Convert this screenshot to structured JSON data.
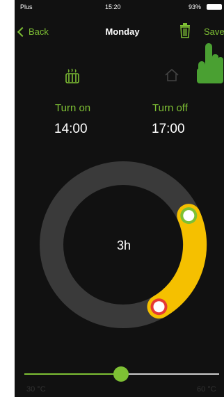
{
  "status_bar": {
    "carrier": "Plus",
    "time": "15:20",
    "battery": "93%"
  },
  "nav": {
    "back_label": "Back",
    "title": "Monday",
    "save_label": "Save"
  },
  "schedule": {
    "on_label": "Turn on",
    "on_time": "14:00",
    "off_label": "Turn off",
    "off_time": "17:00",
    "duration": "3h"
  },
  "temperature": {
    "min_label": "30 °C",
    "max_label": "60 °C"
  },
  "icons": {
    "back": "chevron-left-icon",
    "trash": "trash-icon",
    "heater": "heater-icon",
    "home": "home-icon",
    "hand": "pointing-hand-icon"
  },
  "colors": {
    "accent": "#7ec034",
    "arc": "#f5c000",
    "ring": "#3a3a3a",
    "start_handle": "#7ec034",
    "end_handle": "#e53935",
    "background": "#111111"
  }
}
